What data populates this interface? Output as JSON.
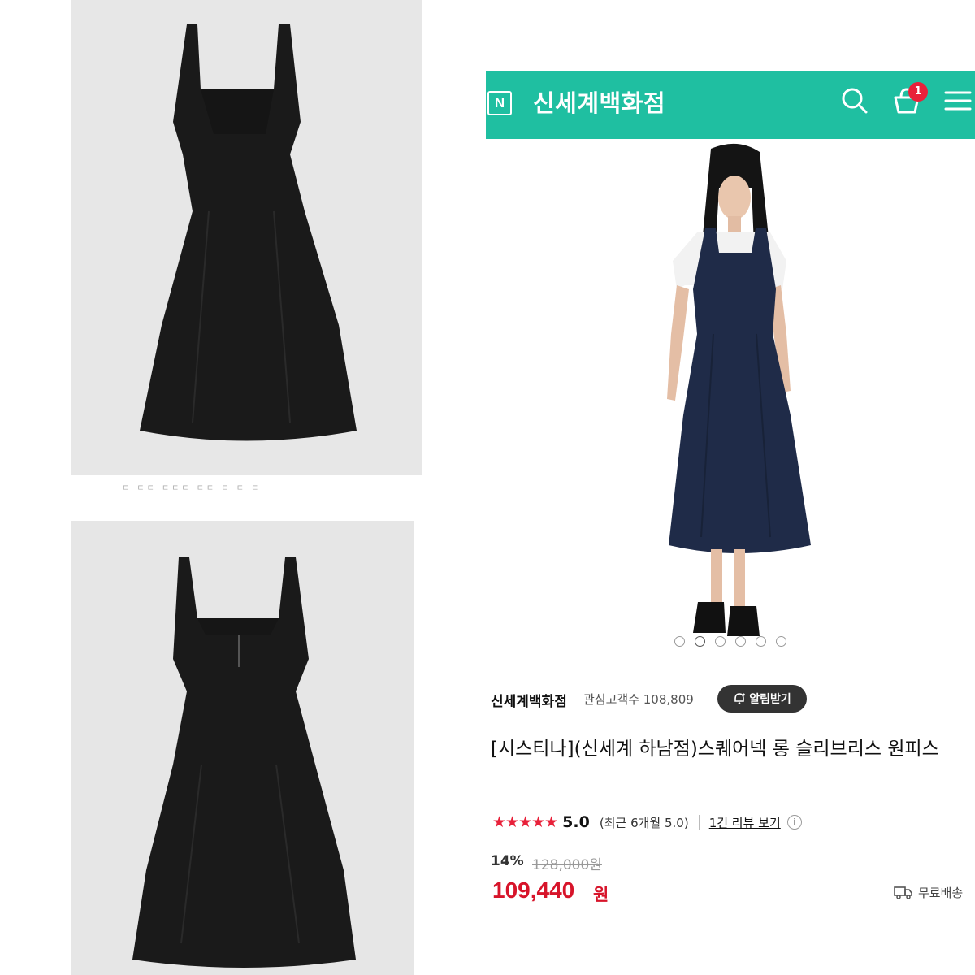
{
  "header": {
    "logo_letter": "N",
    "store_name": "신세계백화점",
    "cart_count": "1"
  },
  "left_images": {
    "top_alt": "black square-neck sleeveless dress front",
    "bottom_alt": "black square-neck sleeveless dress back",
    "caption": "ㄷ ㄷㄷ ㄷㄷㄷ ㄷㄷ ㄷ ㄷ ㄷ"
  },
  "carousel": {
    "count": 6,
    "active_index": 1
  },
  "seller": {
    "name": "신세계백화점",
    "interest": "관심고객수 108,809",
    "notify_label": "알림받기"
  },
  "product": {
    "title": "[시스티나](신세계 하남점)스퀘어넥 롱 슬리브리스 원피스"
  },
  "rating": {
    "stars": "★★★★★",
    "score": "5.0",
    "recent": "(최근 6개월 5.0)",
    "review_link": "1건 리뷰 보기",
    "info": "i"
  },
  "price": {
    "discount": "14%",
    "original": "128,000원",
    "sale": "109,440",
    "unit": "원"
  },
  "shipping": {
    "label": "무료배송"
  },
  "colors": {
    "header_bg": "#1fbfa1",
    "price_red": "#d7142a",
    "badge_red": "#e8213a",
    "dress_black": "#1a1a1a",
    "dress_navy": "#1f2b48"
  }
}
